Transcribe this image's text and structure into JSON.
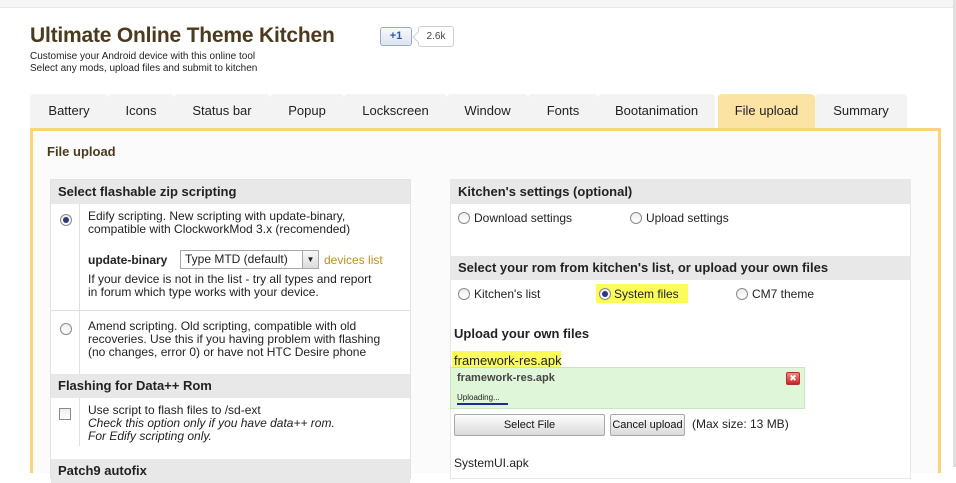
{
  "header": {
    "title": "Ultimate Online Theme Kitchen",
    "subtitle_1": "Customise your Android device with this online tool",
    "subtitle_2": "Select any mods, upload files and submit to kitchen",
    "plusone_label": "+1",
    "plusone_count": "2.6k"
  },
  "tabs": [
    {
      "label": "Battery"
    },
    {
      "label": "Icons"
    },
    {
      "label": "Status bar"
    },
    {
      "label": "Popup"
    },
    {
      "label": "Lockscreen"
    },
    {
      "label": "Window"
    },
    {
      "label": "Fonts"
    },
    {
      "label": "Bootanimation"
    },
    {
      "label": "File upload",
      "active": true
    },
    {
      "label": "Summary"
    }
  ],
  "panel": {
    "title": "File upload",
    "left": {
      "zip_heading": "Select flashable zip scripting",
      "edify_line1": "Edify scripting. New scripting with update-binary,",
      "edify_line2": "compatible with ClockworkMod 3.x (recomended)",
      "update_binary_label": "update-binary",
      "update_binary_value": "Type MTD (default)",
      "devices_link": "devices list",
      "device_note_1": "If your device is not in the list - try all types and report",
      "device_note_2": "in forum which type works with your device.",
      "amend_line1": "Amend scripting. Old scripting, compatible with old",
      "amend_line2": "recoveries. Use this if you having problem with flashing",
      "amend_line3": "(no changes, error 0) or have not HTC Desire phone",
      "dataplus_heading": "Flashing for Data++ Rom",
      "sdext_line1": "Use script to flash files to /sd-ext",
      "sdext_line2": "Check this option only if you have data++ rom.",
      "sdext_line3": "For Edify scripting only.",
      "next_heading_partial": "Patch9 autofix"
    },
    "right": {
      "settings_heading": "Kitchen's settings (optional)",
      "download_settings": "Download settings",
      "upload_settings": "Upload settings",
      "rom_heading": "Select your rom from kitchen's list, or upload your own files",
      "kitchens_list": "Kitchen's list",
      "system_files": "System files",
      "cm7_theme": "CM7 theme",
      "own_files_heading": "Upload your own files",
      "file1_label": "framework-res.apk",
      "file1_name": "framework-res.apk",
      "uploading_label": "Uploading...",
      "close_icon_glyph": "✖",
      "select_file": "Select File",
      "cancel_upload": "Cancel upload",
      "max_size": "(Max size: 13 MB)",
      "file2_label": "SystemUI.apk"
    },
    "selections": {
      "scripting": "Edify scripting",
      "rom_source": "System files",
      "use_sdext_script": false
    }
  },
  "colors": {
    "accent_tab": "#fbe3a4",
    "panel_border": "#fbd37b",
    "title_brown": "#4b3a1e",
    "link_gold": "#b5921b",
    "highlight_yellow": "#fbfb5e",
    "upload_green": "#dff6d8"
  }
}
